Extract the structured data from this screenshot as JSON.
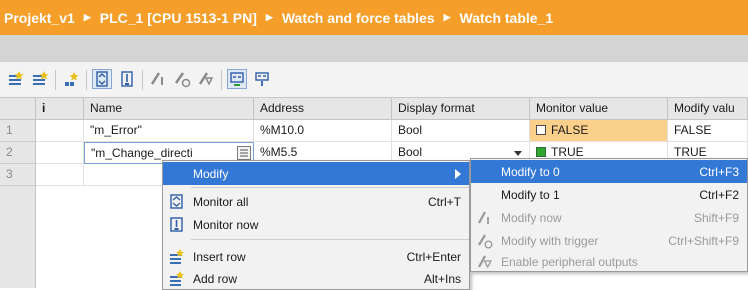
{
  "breadcrumb": [
    "Projekt_v1",
    "PLC_1 [CPU 1513-1 PN]",
    "Watch and force tables",
    "Watch table_1"
  ],
  "toolbar": {
    "icons": [
      "insert-row-icon",
      "add-row-icon",
      "sort-icon",
      "monitor-all-icon",
      "monitor-now-icon",
      "modify-now-icon",
      "modify-with-trigger-icon",
      "enable-peripheral-outputs-icon",
      "show-all-modify-columns-icon",
      "show-monitor-icon"
    ]
  },
  "table": {
    "columns": [
      "",
      "i",
      "Name",
      "Address",
      "Display format",
      "Monitor value",
      "Modify valu"
    ],
    "rows": [
      {
        "num": "1",
        "name": "\"m_Error\"",
        "address": "%M10.0",
        "format": "Bool",
        "monitor": "FALSE",
        "modify": "FALSE"
      },
      {
        "num": "2",
        "name": "\"m_Change_directi",
        "address": "%M5.5",
        "format": "Bool",
        "monitor": "TRUE",
        "modify": "TRUE"
      },
      {
        "num": "3",
        "name": "",
        "address": "",
        "format": "",
        "monitor": "",
        "modify": ""
      }
    ]
  },
  "context_menu": {
    "modify": "Modify",
    "monitor_all": "Monitor all",
    "monitor_all_shortcut": "Ctrl+T",
    "monitor_now": "Monitor now",
    "insert_row": "Insert row",
    "insert_row_shortcut": "Ctrl+Enter",
    "add_row": "Add row",
    "add_row_shortcut": "Alt+Ins"
  },
  "submenu": {
    "modify_to_0": "Modify to 0",
    "modify_to_0_shortcut": "Ctrl+F3",
    "modify_to_1": "Modify to 1",
    "modify_to_1_shortcut": "Ctrl+F2",
    "modify_now": "Modify now",
    "modify_now_shortcut": "Shift+F9",
    "modify_with_trigger": "Modify with trigger",
    "modify_with_trigger_shortcut": "Ctrl+Shift+F9",
    "enable_peripheral_outputs": "Enable peripheral outputs"
  },
  "colors": {
    "title_bar": "#f59f2a",
    "highlight": "#3478d6",
    "monitor_cell": "#fbd08a",
    "true_indicator": "#2ea52e"
  }
}
